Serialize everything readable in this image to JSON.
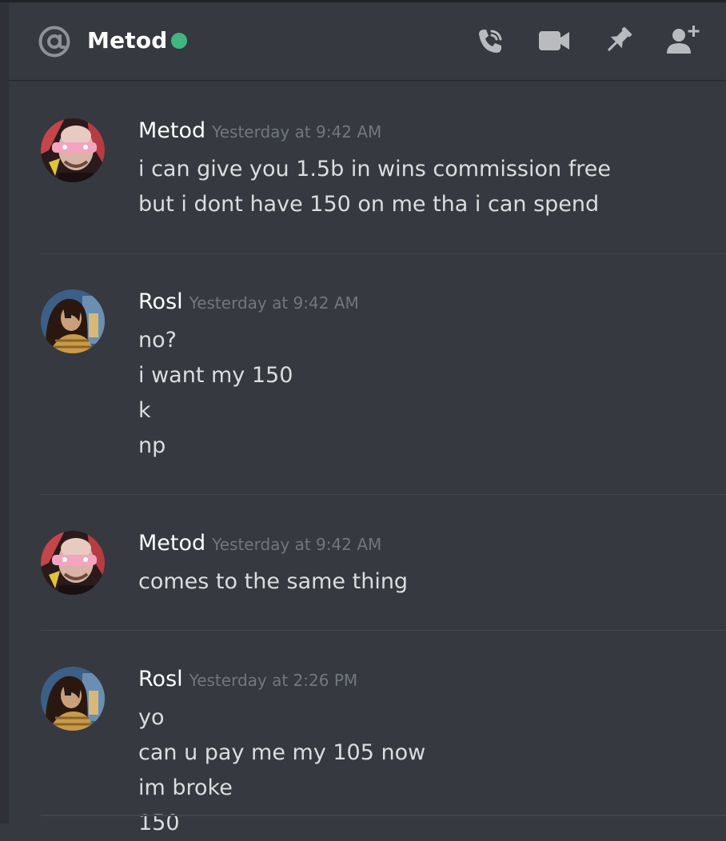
{
  "header": {
    "channel_name": "Metod",
    "status": "online",
    "icons": [
      "at-icon",
      "phone-call-icon",
      "video-call-icon",
      "pin-icon",
      "add-friend-icon"
    ]
  },
  "colors": {
    "background": "#36393f",
    "status_online": "#43b581",
    "author": "#ffffff",
    "message_text": "#dcddde",
    "timestamp": "#72767d"
  },
  "messages": [
    {
      "author": "Metod",
      "timestamp": "Yesterday at 9:42 AM",
      "lines": [
        "i can give you 1.5b in wins commission free",
        "but i dont have 150 on me tha i can spend"
      ]
    },
    {
      "author": "Rosl",
      "timestamp": "Yesterday at 9:42 AM",
      "lines": [
        "no?",
        "i want my 150",
        "k",
        "np"
      ]
    },
    {
      "author": "Metod",
      "timestamp": "Yesterday at 9:42 AM",
      "lines": [
        "comes to the same thing"
      ]
    },
    {
      "author": "Rosl",
      "timestamp": "Yesterday at 2:26 PM",
      "lines": [
        "yo",
        "can u pay me my 105 now",
        "im broke",
        "150"
      ]
    }
  ]
}
